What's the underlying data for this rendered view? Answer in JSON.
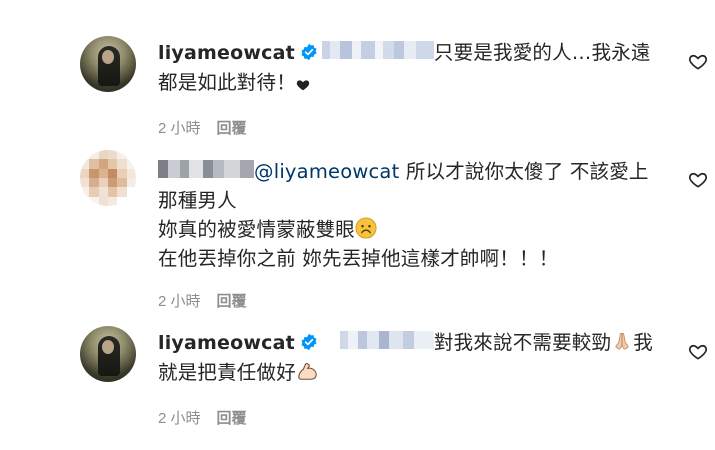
{
  "comments": [
    {
      "username": "liyameowcat",
      "verified": true,
      "line1": "只要是我愛的人…我永遠",
      "line2": "都是如此對待！",
      "line2_emoji": "black-heart",
      "time": "2 小時",
      "reply": "回覆"
    },
    {
      "mention": "@liyameowcat",
      "line1_after": "所以才說你太傻了 不該愛上",
      "line2": "那種男人",
      "line3": "妳真的被愛情蒙蔽雙眼",
      "line3_emoji": "sad-face",
      "line4": "在他丟掉你之前 妳先丟掉他這樣才帥啊！！！",
      "time": "2 小時",
      "reply": "回覆"
    },
    {
      "username": "liyameowcat",
      "verified": true,
      "line1": "對我來說不需要較勁",
      "line1_emoji": "praying-hands",
      "line1_after": "我",
      "line2": "就是把責任做好",
      "line2_emoji": "flexed-biceps",
      "time": "2 小時",
      "reply": "回覆"
    }
  ],
  "colors": {
    "text": "#262626",
    "meta": "#8e8e8e",
    "mention": "#00376b",
    "verified": "#0095f6"
  }
}
